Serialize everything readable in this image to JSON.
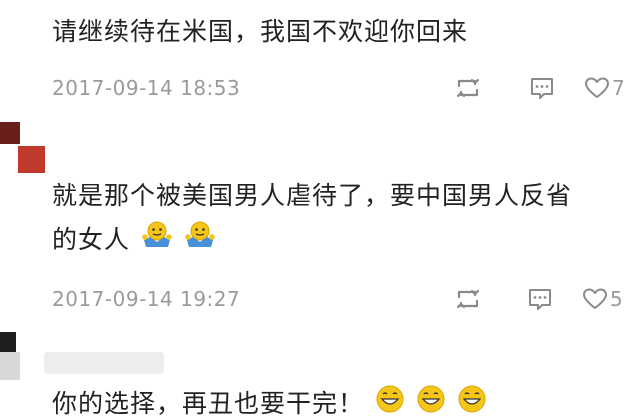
{
  "comments": [
    {
      "line1": "请继续待在米国，我国不欢迎你回来",
      "timestamp": "2017-09-14 18:53",
      "like_count": "7",
      "retweet_icon": "retweet-icon",
      "reply_icon": "comment-icon",
      "like_icon": "heart-icon"
    },
    {
      "line1": "就是那个被美国男人虐待了，要中国男人反省",
      "line2": "的女人",
      "emojis": [
        "shrug-emoji",
        "shrug-emoji"
      ],
      "timestamp": "2017-09-14 19:27",
      "like_count": "5",
      "retweet_icon": "retweet-icon",
      "reply_icon": "comment-icon",
      "like_icon": "heart-icon"
    },
    {
      "line1": "你的选择，再丑也要干完！",
      "emojis": [
        "grin-emoji",
        "grin-emoji",
        "grin-emoji"
      ]
    }
  ],
  "colors": {
    "avatar_red": "#c0392b",
    "avatar_dark": "#1e1e1e",
    "meta_gray": "#9a9a9a",
    "emoji_yellow": "#f5c518",
    "emoji_blue": "#4a90d9"
  }
}
